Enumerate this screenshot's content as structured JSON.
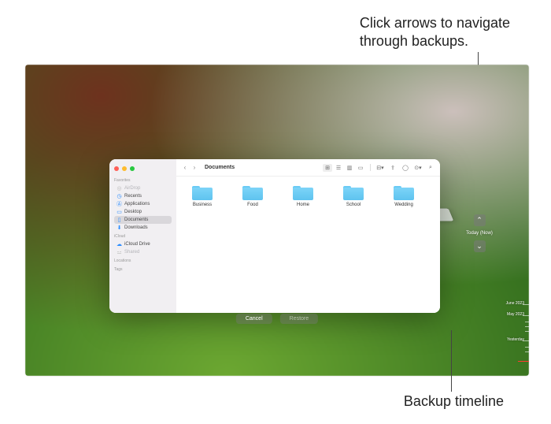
{
  "annotations": {
    "top": "Click arrows to navigate\nthrough backups.",
    "bottom": "Backup timeline"
  },
  "finder": {
    "title": "Documents",
    "sidebar": {
      "groups": [
        {
          "head": "Favorites",
          "items": [
            {
              "icon": "airdrop-icon",
              "label": "AirDrop",
              "dim": true
            },
            {
              "icon": "clock-icon",
              "label": "Recents"
            },
            {
              "icon": "app-icon",
              "label": "Applications"
            },
            {
              "icon": "desktop-icon",
              "label": "Desktop"
            },
            {
              "icon": "doc-icon",
              "label": "Documents",
              "sel": true
            },
            {
              "icon": "download-icon",
              "label": "Downloads"
            }
          ]
        },
        {
          "head": "iCloud",
          "items": [
            {
              "icon": "cloud-icon",
              "label": "iCloud Drive"
            },
            {
              "icon": "shared-icon",
              "label": "Shared",
              "dim": true
            }
          ]
        },
        {
          "head": "Locations",
          "items": []
        },
        {
          "head": "Tags",
          "items": []
        }
      ]
    },
    "folders": [
      {
        "label": "Business"
      },
      {
        "label": "Food"
      },
      {
        "label": "Home"
      },
      {
        "label": "School"
      },
      {
        "label": "Wedding"
      }
    ]
  },
  "nav": {
    "now_label": "Today (Now)"
  },
  "timeline": {
    "labels": [
      "June 2023",
      "May 2023",
      "Yesterday"
    ]
  },
  "bottom": {
    "cancel": "Cancel",
    "restore": "Restore"
  },
  "toolbar": {
    "view_icons": [
      "grid",
      "list",
      "col",
      "gallery"
    ]
  }
}
